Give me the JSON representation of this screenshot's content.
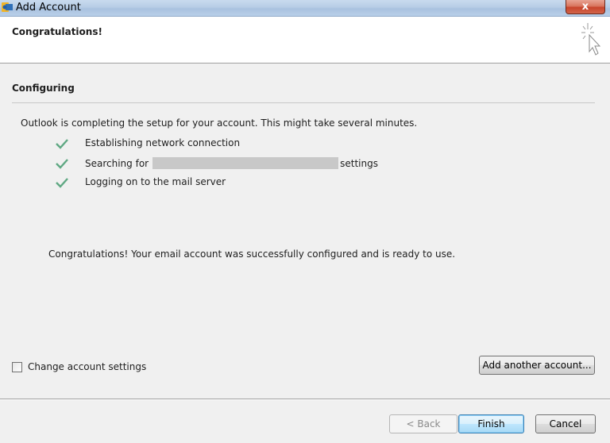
{
  "window": {
    "title": "Add Account",
    "close_label": "x"
  },
  "header": {
    "title": "Congratulations!"
  },
  "section": {
    "heading": "Configuring",
    "intro": "Outlook is completing the setup for your account. This might take several minutes."
  },
  "steps": [
    {
      "label": "Establishing network connection",
      "status": "done"
    },
    {
      "label_before": "Searching for",
      "label_after": "settings",
      "status": "done"
    },
    {
      "label": "Logging on to the mail server",
      "status": "done"
    }
  ],
  "result": {
    "message": "Congratulations! Your email account was successfully configured and is ready to use."
  },
  "options": {
    "change_settings_label": "Change account settings",
    "change_settings_checked": false,
    "add_another_label": "Add another account..."
  },
  "footer": {
    "back_label": "< Back",
    "finish_label": "Finish",
    "cancel_label": "Cancel"
  },
  "colors": {
    "check": "#5fa883",
    "header_bg": "#ffffff",
    "dialog_bg": "#f0f0f0",
    "redaction": "#c8c8c8"
  },
  "icons": {
    "app": "outlook-icon",
    "header": "cursor-sparkle-icon",
    "step": "checkmark-icon"
  }
}
